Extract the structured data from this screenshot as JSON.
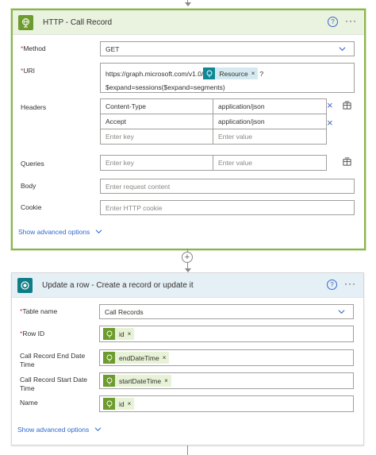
{
  "http_card": {
    "title": "HTTP - Call Record",
    "help_glyph": "?",
    "more_glyph": "···",
    "method_label": "Method",
    "method_value": "GET",
    "uri_label": "URI",
    "uri_prefix": "https://graph.microsoft.com/v1.0/",
    "uri_token": "Resource",
    "uri_suffix": "?",
    "uri_line2": "$expand=sessions($expand=segments)",
    "headers_label": "Headers",
    "headers": [
      {
        "key": "Content-Type",
        "value": "application/json"
      },
      {
        "key": "Accept",
        "value": "application/json"
      }
    ],
    "key_placeholder": "Enter key",
    "value_placeholder": "Enter value",
    "queries_label": "Queries",
    "body_label": "Body",
    "body_placeholder": "Enter request content",
    "cookie_label": "Cookie",
    "cookie_placeholder": "Enter HTTP cookie",
    "advanced_label": "Show advanced options"
  },
  "dv_card": {
    "title": "Update a row - Create a record or update it",
    "help_glyph": "?",
    "more_glyph": "···",
    "table_label": "Table name",
    "table_value": "Call Records",
    "rowid_label": "Row ID",
    "rowid_token": "id",
    "end_label_1": "Call Record End Date",
    "end_label_2": "Time",
    "end_token": "endDateTime",
    "start_label_1": "Call Record Start Date",
    "start_label_2": "Time",
    "start_token": "startDateTime",
    "name_label": "Name",
    "name_token": "id",
    "advanced_label": "Show advanced options"
  },
  "required_marker": "*",
  "remove_glyph": "×",
  "plus_glyph": "+",
  "colors": {
    "accent_green": "#6c9b2e",
    "teal": "#0f8896",
    "link_blue": "#2e6ad0",
    "selected_border": "#89b44d"
  }
}
